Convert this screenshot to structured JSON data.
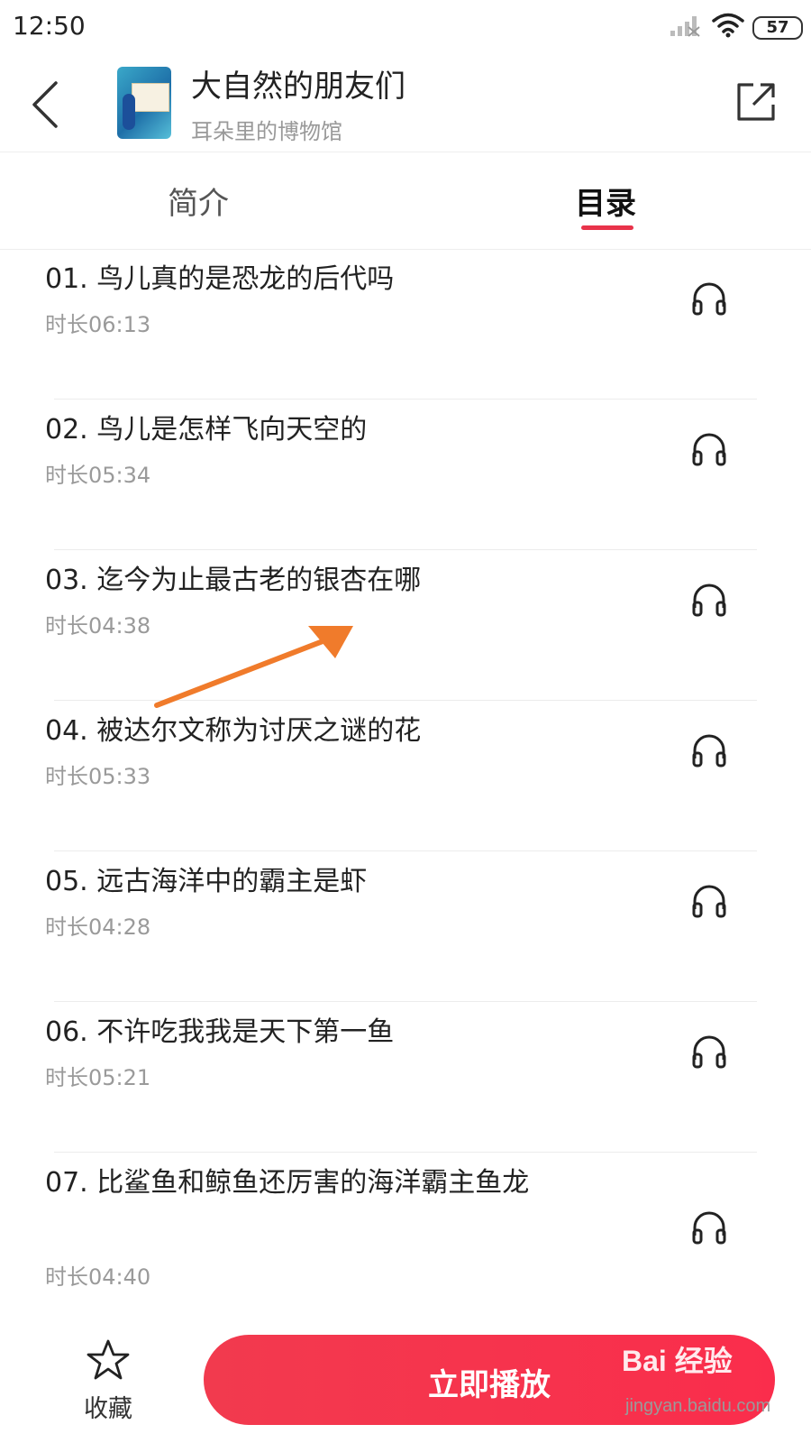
{
  "status_bar": {
    "time": "12:50",
    "battery": "57"
  },
  "header": {
    "title": "大自然的朋友们",
    "subtitle": "耳朵里的博物馆"
  },
  "tabs": [
    {
      "label": "简介",
      "active": false
    },
    {
      "label": "目录",
      "active": true
    }
  ],
  "accent_color": "#e8334a",
  "episodes": [
    {
      "title": "01. 鸟儿真的是恐龙的后代吗",
      "duration": "时长06:13"
    },
    {
      "title": "02. 鸟儿是怎样飞向天空的",
      "duration": "时长05:34"
    },
    {
      "title": "03. 迄今为止最古老的银杏在哪",
      "duration": "时长04:38"
    },
    {
      "title": "04. 被达尔文称为讨厌之谜的花",
      "duration": "时长05:33"
    },
    {
      "title": "05. 远古海洋中的霸主是虾",
      "duration": "时长04:28"
    },
    {
      "title": "06. 不许吃我我是天下第一鱼",
      "duration": "时长05:21"
    },
    {
      "title": "07. 比鲨鱼和鲸鱼还厉害的海洋霸主鱼龙",
      "duration": "时长04:40"
    }
  ],
  "bottom_bar": {
    "favorite_label": "收藏",
    "play_label": "立即播放"
  },
  "watermark": {
    "brand": "Bai 经验",
    "url": "jingyan.baidu.com"
  },
  "annotation": {
    "type": "arrow",
    "color": "#f07b2b"
  }
}
